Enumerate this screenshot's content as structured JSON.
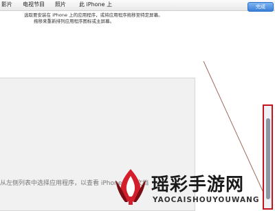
{
  "tabs": [
    {
      "label": "影片"
    },
    {
      "label": "电视节目"
    },
    {
      "label": "照片"
    },
    {
      "label": "此 iPhone 上"
    }
  ],
  "done_label": "完成",
  "instructions": {
    "line1": "选取要安装在 iPhone 上的应用程序，或将应用程序拖移至特定屏幕。",
    "line2": "拖移来重新排列应用程序图标或主屏幕。"
  },
  "empty_hint": "从左侧列表中选择应用程序，以查看 iPhone 上的文档",
  "watermark": {
    "title": "瑶彩手游网",
    "subtitle": "YAOCAISHOUYOUWANG"
  },
  "colors": {
    "accent": "#3a7fd8",
    "highlight_frame": "#c3141c",
    "watermark_red": "#d21f2b"
  }
}
